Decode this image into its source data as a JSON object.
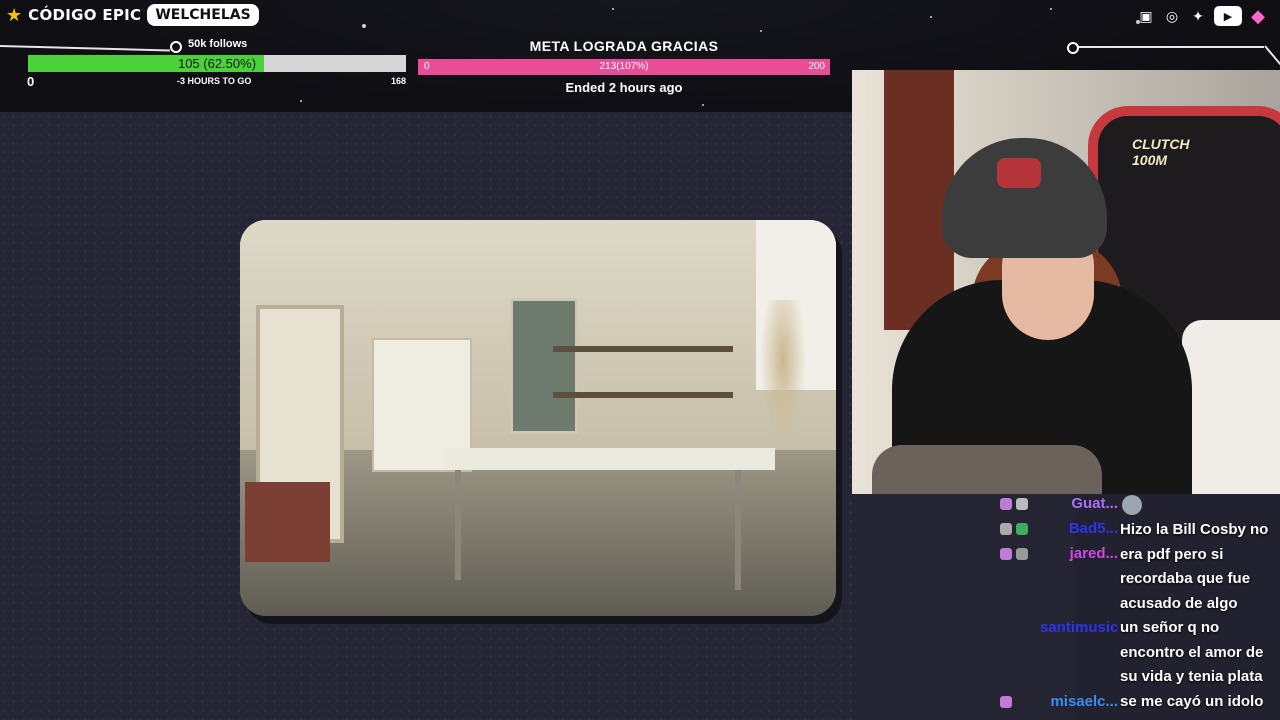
{
  "header": {
    "brand_text": "CÓDIGO EPIC",
    "brand_badge": "WELCHELAS",
    "socials": [
      "twitch-icon",
      "instagram-icon",
      "twitter-icon",
      "youtube-icon",
      "gem-icon"
    ]
  },
  "follow_goal": {
    "label": "50k follows",
    "current_text": "105 (62.50%)",
    "progress": 0.625,
    "min": "0",
    "time_left": "-3 HOURS TO GO",
    "max": "168"
  },
  "sub_goal": {
    "title": "META LOGRADA GRACIAS",
    "min": "0",
    "current_text": "213(107%)",
    "progress": 1.0,
    "max": "200",
    "ended": "Ended 2 hours ago"
  },
  "webcam": {
    "chair_text": "CLUTCH\n100M"
  },
  "chat": {
    "messages": [
      {
        "user": "Guat...",
        "color": "#a971f7",
        "text": "",
        "emote": true
      },
      {
        "user": "Bad5...",
        "color": "#2c33e8",
        "text": "Hizo la Bill Cosby no era pdf pero si recordaba que fue acusado de algo"
      },
      {
        "user": "jared...",
        "color": "#d04ae0",
        "text": ""
      },
      {
        "user": "santimusic...",
        "color": "#2c33e8",
        "text": "un señor q no encontro el amor de su vida y tenia plata"
      },
      {
        "user": "misaelc...",
        "color": "#3a8df2",
        "text": "se me cayó un idolo"
      }
    ],
    "colors": {
      "accent": "#4bd13a",
      "pink": "#ea4d97"
    }
  }
}
